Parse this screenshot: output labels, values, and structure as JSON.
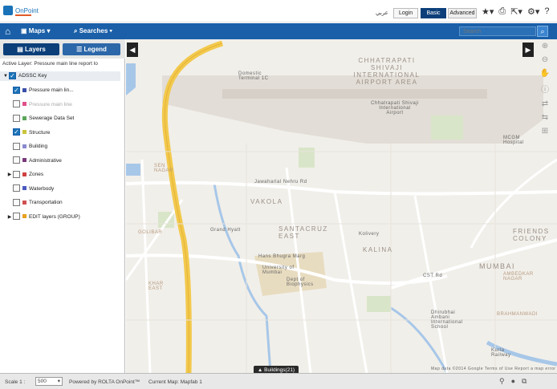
{
  "header": {
    "logo_text": "OnPoint",
    "lang_label": "عربي",
    "login_label": "Login",
    "basic_label": "Basic",
    "advanced_label": "Advanced",
    "icons": [
      "star-icon",
      "print-icon",
      "export-icon",
      "gear-icon",
      "help-icon"
    ]
  },
  "nav": {
    "maps_label": "Maps",
    "searches_label": "Searches",
    "search_placeholder": "Search"
  },
  "panel": {
    "tab_layers": "Layers",
    "tab_legend": "Legend",
    "active_layer": "Active Layer: Pressure main line report lo",
    "root_label": "ADSSC Key",
    "layers": [
      {
        "label": "Pressure main lin...",
        "checked": true,
        "color": "#3b4fa8",
        "dim": false,
        "expander": false
      },
      {
        "label": "Pressure main line",
        "checked": false,
        "color": "#e0508a",
        "dim": true,
        "expander": false
      },
      {
        "label": "Sewerage Data Set",
        "checked": false,
        "color": "#5aa55a",
        "dim": false,
        "expander": false
      },
      {
        "label": "Structure",
        "checked": true,
        "color": "#c9c43a",
        "dim": false,
        "expander": false
      },
      {
        "label": "Building",
        "checked": false,
        "color": "#8a8ad0",
        "dim": false,
        "expander": false
      },
      {
        "label": "Administrative",
        "checked": false,
        "color": "#7a3a7a",
        "dim": false,
        "expander": false
      },
      {
        "label": "Zones",
        "checked": false,
        "color": "#d04040",
        "dim": false,
        "expander": true
      },
      {
        "label": "Waterbody",
        "checked": false,
        "color": "#4a5ac0",
        "dim": false,
        "expander": false
      },
      {
        "label": "Transportation",
        "checked": false,
        "color": "#d05050",
        "dim": false,
        "expander": false
      },
      {
        "label": "EDIT layers (GROUP)",
        "checked": false,
        "color": "#e8a020",
        "dim": false,
        "expander": true
      }
    ]
  },
  "map": {
    "labels": [
      "CHHATRAPATI SHIVAJI INTERNATIONAL AIRPORT AREA",
      "Chhatrapati Shivaji International Airport",
      "Domestic Terminal 1C",
      "SEN NAGAR",
      "VAKOLA",
      "SANTACRUZ EAST",
      "KALINA",
      "GOLIBAR",
      "KHAR EAST",
      "MUMBAI",
      "University of Mumbai",
      "Dept of Biophysics",
      "Grand Hyatt",
      "Kolivery",
      "Jawaharlal Nehru Rd",
      "Hans Bhugra Marg",
      "CST Rd",
      "MCGM Hospital",
      "FRIENDS COLONY",
      "AMBEDKAR NAGAR",
      "BRAHMANWADI",
      "Dhirubhai Ambani International School",
      "Kurla Railway",
      "Map data ©2014 Google   Terms of Use   Report a map error"
    ]
  },
  "footer": {
    "scale_label": "Scale 1 :",
    "scale_value": "500",
    "powered_by": "Powered by ROLTA OnPoint™",
    "current_map": "Current Map: Mapfab 1",
    "buildings_label": "Buildings(21)"
  }
}
